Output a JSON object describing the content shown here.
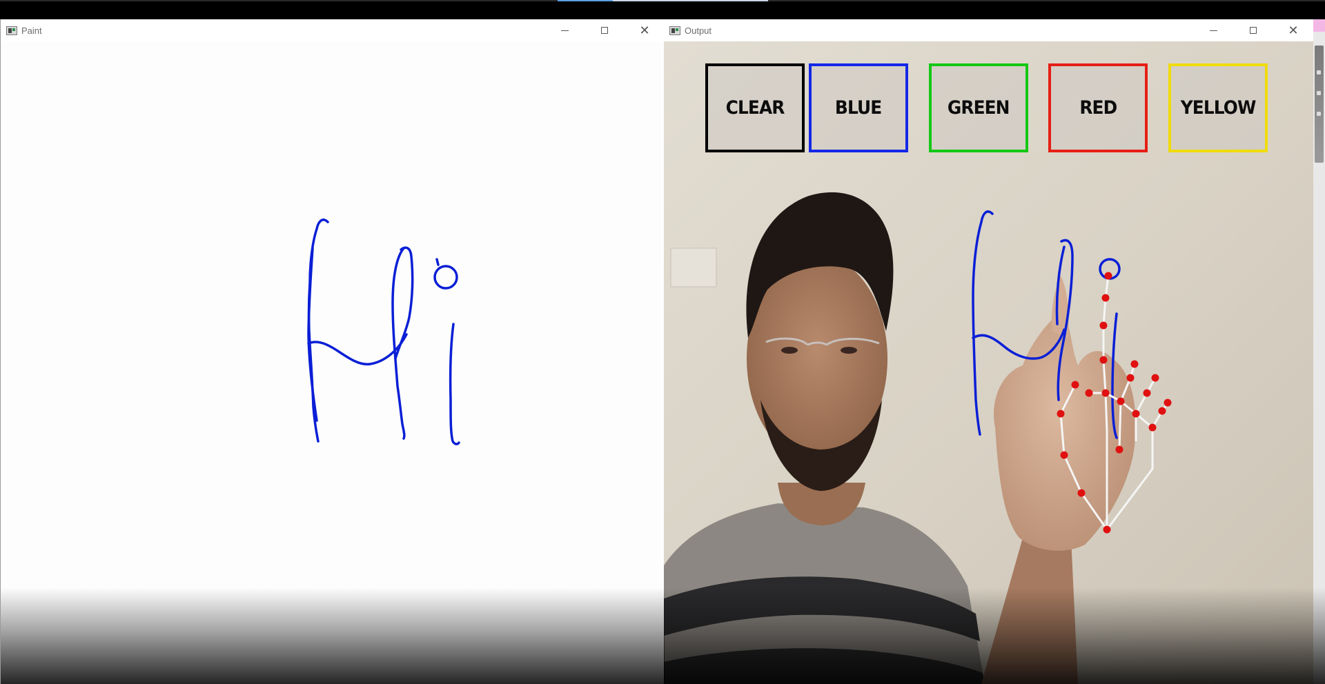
{
  "paint_window": {
    "title": "Paint",
    "icon": "window-app-icon",
    "drawing": {
      "stroke_color": "#0a1fd6",
      "content": "Hi"
    }
  },
  "output_window": {
    "title": "Output",
    "icon": "window-app-icon",
    "color_buttons": [
      {
        "label": "CLEAR",
        "border_color": "#000000"
      },
      {
        "label": "BLUE",
        "border_color": "#1428e6"
      },
      {
        "label": "GREEN",
        "border_color": "#14c814"
      },
      {
        "label": "RED",
        "border_color": "#e61e14"
      },
      {
        "label": "YELLOW",
        "border_color": "#f0dc0a"
      }
    ],
    "hand_landmarks": {
      "point_color": "#e01010",
      "line_color": "#f5f5f5"
    }
  },
  "window_controls": {
    "minimize": "minimize-icon",
    "maximize": "maximize-icon",
    "close": "close-icon"
  },
  "colors": {
    "stroke_blue": "#0a1fd6",
    "wall": "#ddd7cc",
    "shirt_dark": "#2a2a2c",
    "shirt_grey": "#8a8580"
  }
}
